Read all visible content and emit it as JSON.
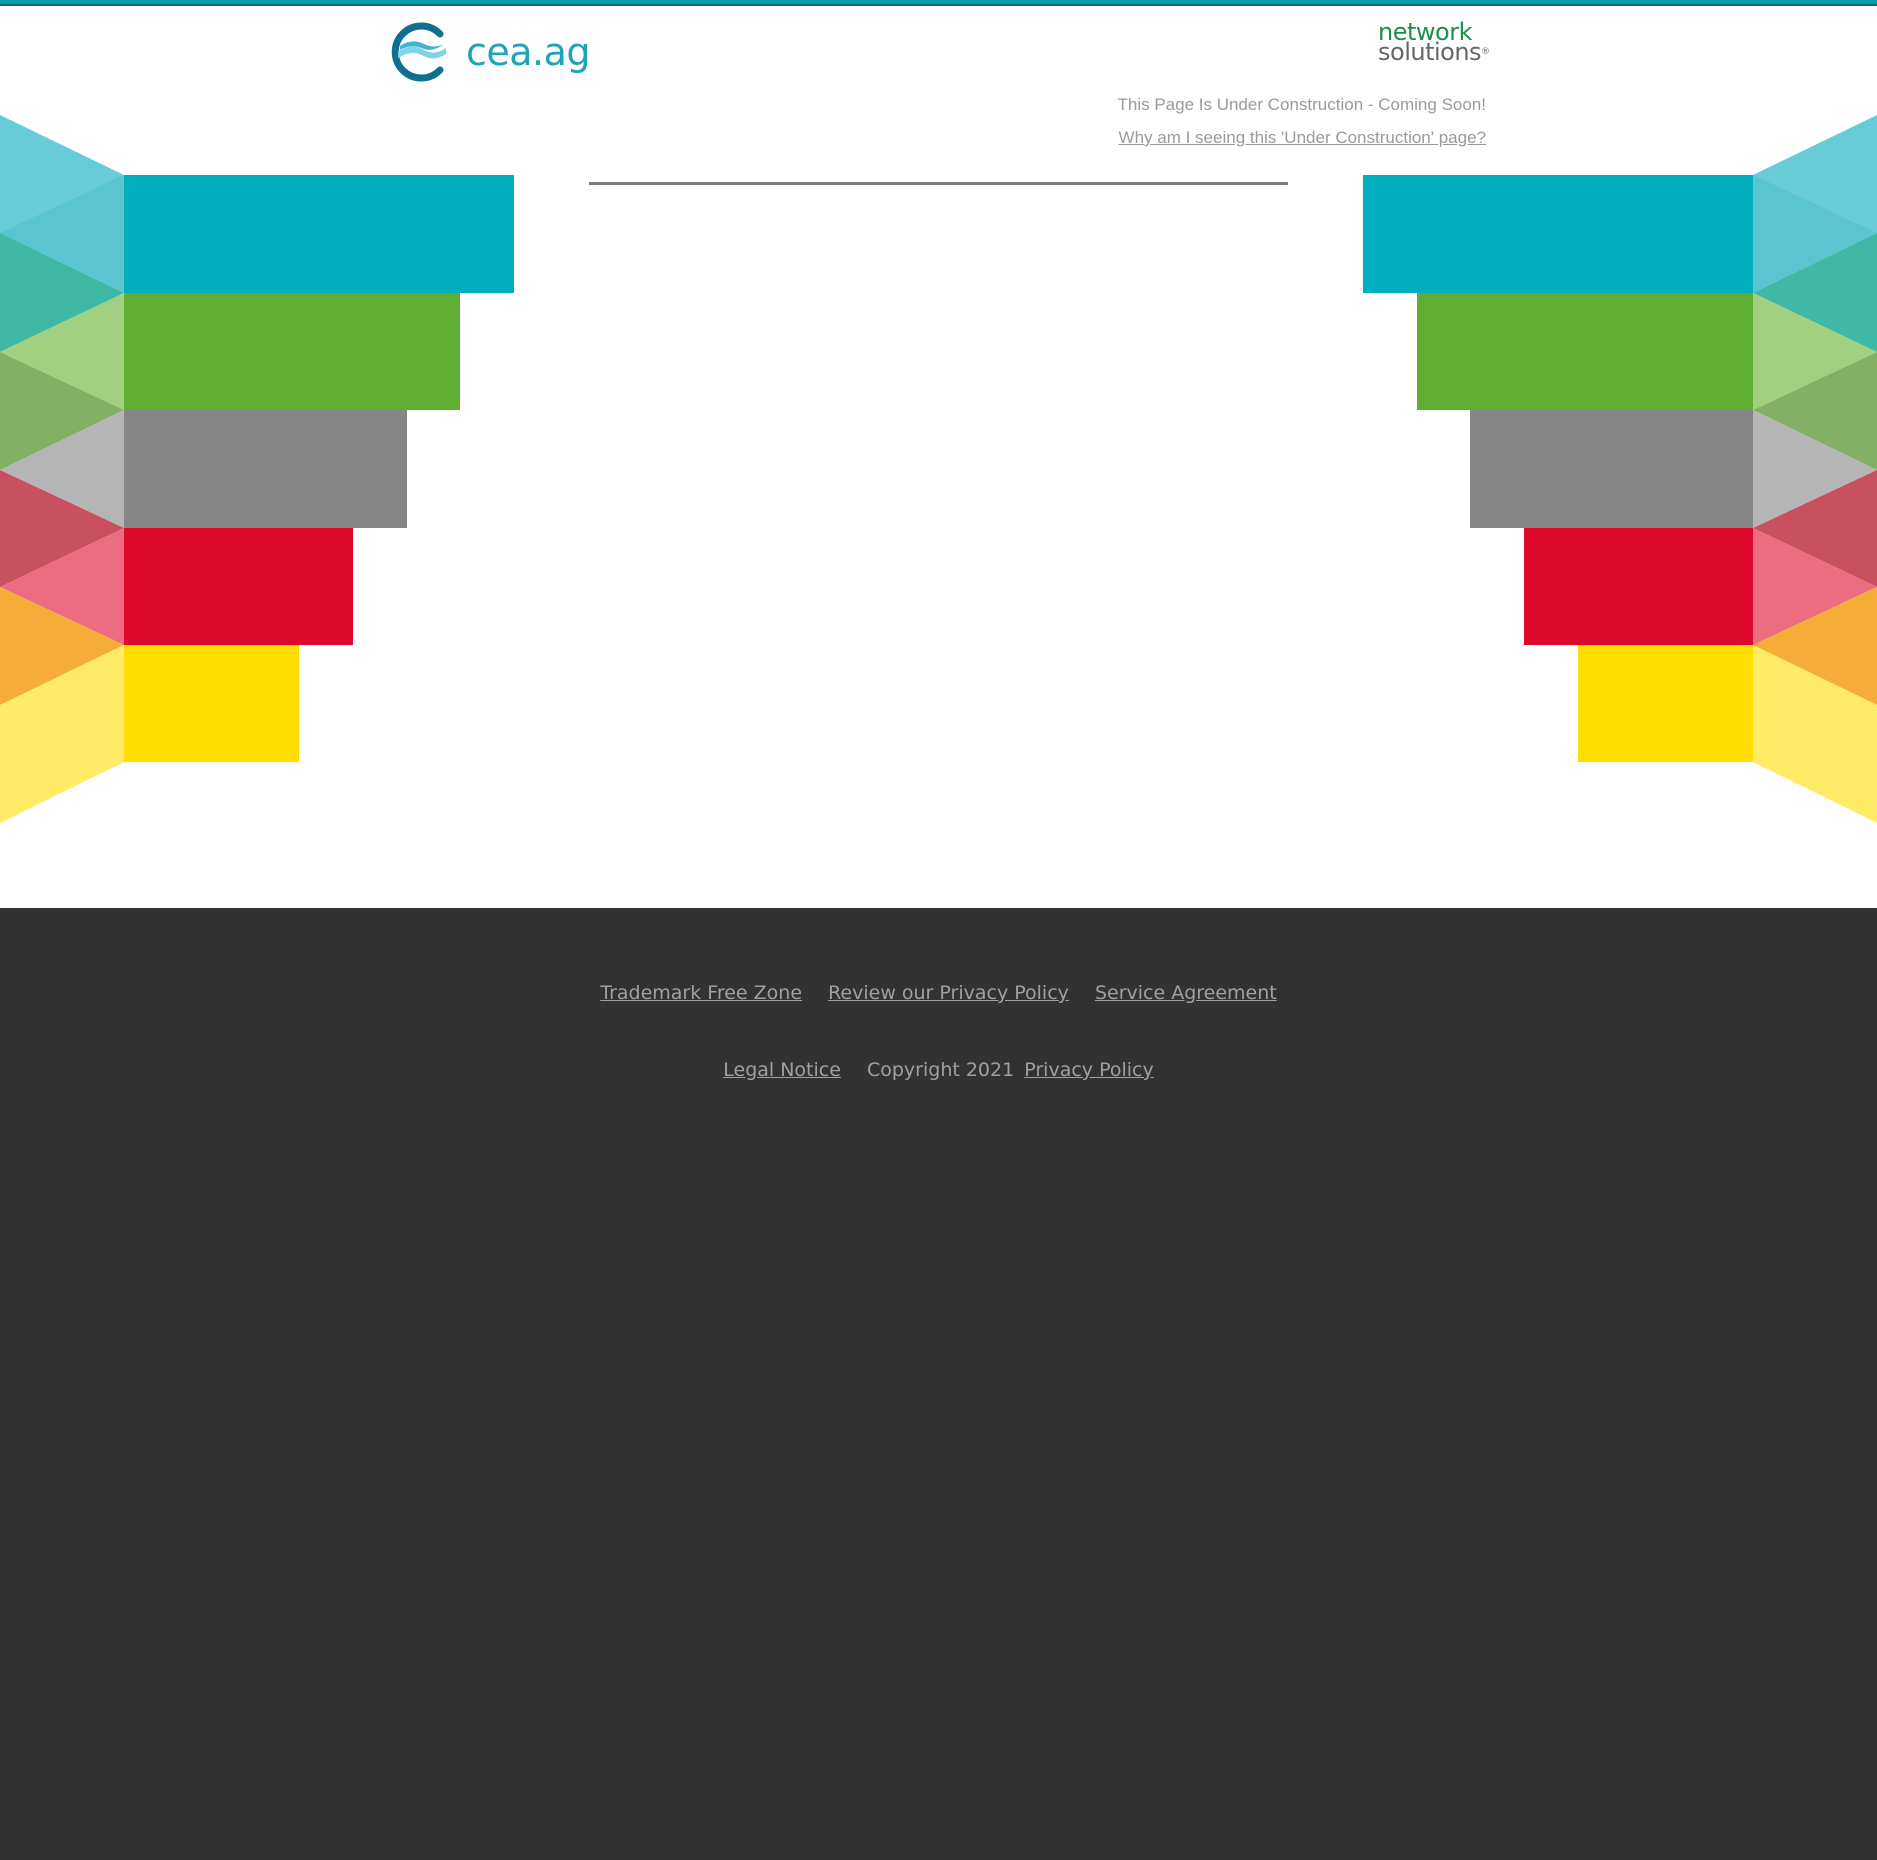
{
  "header": {
    "site_name": "cea.ag",
    "partner_logo_line1": "network",
    "partner_logo_line2": "solutions",
    "status_message": "This Page Is Under Construction - Coming Soon!",
    "why_link": "Why am I seeing this 'Under Construction' page?"
  },
  "colors": {
    "accent": "#0d9aab",
    "teal": "#00aebf",
    "green": "#5fad32",
    "gray": "#858585",
    "red": "#dd0a2d",
    "yellow": "#ffdd00",
    "footer_bg": "#323232"
  },
  "footer": {
    "links_row1": [
      {
        "label": "Trademark Free Zone"
      },
      {
        "label": "Review our Privacy Policy"
      },
      {
        "label": "Service Agreement"
      }
    ],
    "legal_notice": "Legal Notice",
    "copyright": "Copyright 2021",
    "privacy_policy": "Privacy Policy"
  }
}
